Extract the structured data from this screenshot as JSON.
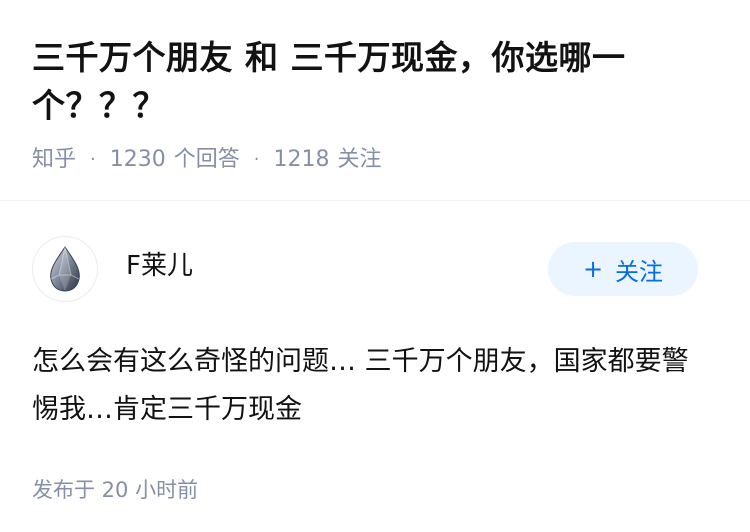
{
  "question": {
    "title": "三千万个朋友 和 三千万现金，你选哪一个？？？",
    "source": "知乎",
    "answers_count": "1230",
    "answers_label": "个回答",
    "follows_count": "1218",
    "follows_label": "关注",
    "separator": "·"
  },
  "answer": {
    "author_name": "F莱儿",
    "avatar_icon": "diamond-icon",
    "follow_plus": "+",
    "follow_label": "关注",
    "content": "怎么会有这么奇怪的问题… 三千万个朋友，国家都要警惕我…肯定三千万现金",
    "time_label": "发布于 20 小时前"
  },
  "colors": {
    "meta_gray": "#8590a6",
    "accent_blue": "#056de8",
    "follow_bg": "#ebf5ff"
  }
}
